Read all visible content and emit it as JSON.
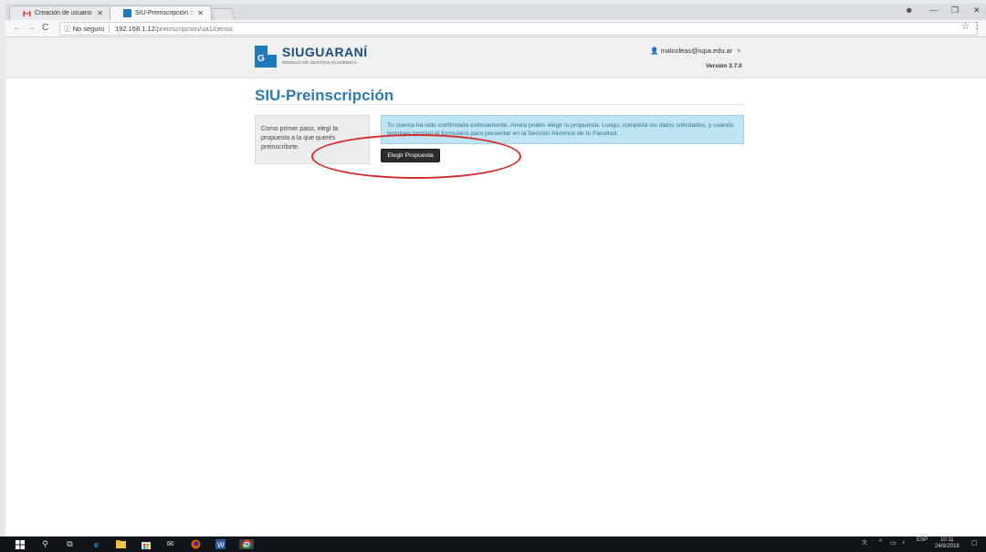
{
  "browser": {
    "tabs": [
      {
        "title": "Creación de usuario de S",
        "icon": "gmail-icon",
        "active": false
      },
      {
        "title": "SIU-Preinscripción :: Carg",
        "icon": "siu-favicon-icon",
        "active": true
      }
    ],
    "security_label": "No seguro",
    "url_host": "192.168.1.12",
    "url_path": "/preinscripcion/ua1/censo"
  },
  "header": {
    "logo_text_1": "SIU",
    "logo_text_2": "GUARANÍ",
    "logo_subtitle": "MÓDULO DE GESTIÓN ACADÉMICA",
    "user_email": "malcoleas@iupa.edu.ar",
    "version": "Versión 3.7.0"
  },
  "main": {
    "title": "SIU-Preinscripción",
    "step_text": "Como primer paso, elegí la propuesta a la que querés preinscribirte.",
    "alert_text": "Tu cuenta ha sido confirmada exitosamente. Ahora podés elegir la propuesta. Luego, completá los datos solicitados, y cuando termines imprimí el formulario para presentar en la Sección Alumnos de tu Facultad.",
    "button_label": "Elegir Propuesta"
  },
  "taskbar": {
    "language": "ESP",
    "time": "10:11",
    "date": "24/8/2018"
  },
  "colors": {
    "title_blue": "#2c7db4",
    "alert_bg": "#bde4f0",
    "annotation_red": "#d42a2a",
    "logo_blue": "#1e7ab8"
  }
}
